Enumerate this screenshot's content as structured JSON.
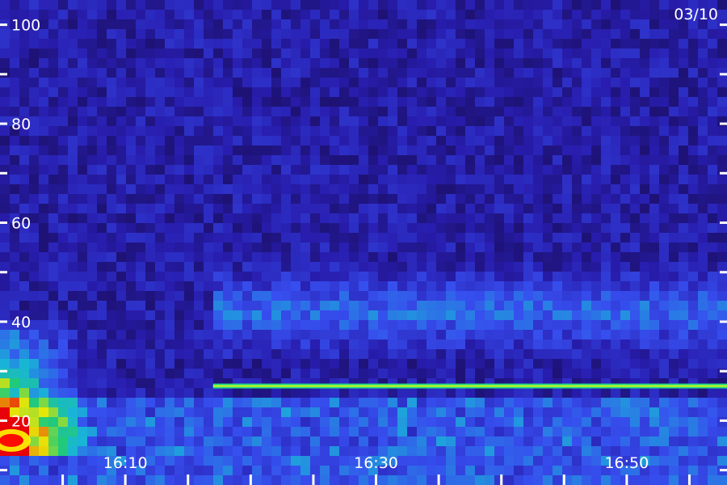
{
  "chart_data": {
    "type": "heatmap",
    "date_label": "03/10",
    "y_ticks": [
      {
        "value": 100,
        "label": "100"
      },
      {
        "value": 90,
        "label": ""
      },
      {
        "value": 80,
        "label": "80"
      },
      {
        "value": 70,
        "label": ""
      },
      {
        "value": 60,
        "label": "60"
      },
      {
        "value": 50,
        "label": ""
      },
      {
        "value": 40,
        "label": "40"
      },
      {
        "value": 30,
        "label": ""
      },
      {
        "value": 20,
        "label": "20"
      },
      {
        "value": 10,
        "label": ""
      }
    ],
    "x_ticks": [
      {
        "value": "16:05",
        "label": ""
      },
      {
        "value": "16:10",
        "label": "16:10"
      },
      {
        "value": "16:15",
        "label": ""
      },
      {
        "value": "16:20",
        "label": ""
      },
      {
        "value": "16:25",
        "label": ""
      },
      {
        "value": "16:30",
        "label": "16:30"
      },
      {
        "value": "16:35",
        "label": ""
      },
      {
        "value": "16:40",
        "label": ""
      },
      {
        "value": "16:45",
        "label": ""
      },
      {
        "value": "16:50",
        "label": "16:50"
      },
      {
        "value": "16:55",
        "label": ""
      }
    ],
    "xlim": [
      "16:00",
      "16:58"
    ],
    "ylim": [
      7,
      105
    ],
    "background_color": "#1a0a55",
    "colormap": [
      "#14083f",
      "#2a1fb8",
      "#3a55ff",
      "#19c8e6",
      "#22e07a",
      "#ffff00",
      "#ff0000"
    ],
    "features": [
      {
        "name": "steady band",
        "t_start": "16:17",
        "t_end": "16:58",
        "y": 27,
        "intensity": 0.55
      },
      {
        "name": "diffuse band",
        "t_start": "16:17",
        "t_end": "16:58",
        "y": 42,
        "intensity": 0.3
      },
      {
        "name": "burst",
        "t_start": "16:00",
        "t_end": "16:05",
        "y_low": 12,
        "y_high": 40,
        "peak_y": 16,
        "intensity": 1.0
      }
    ]
  }
}
